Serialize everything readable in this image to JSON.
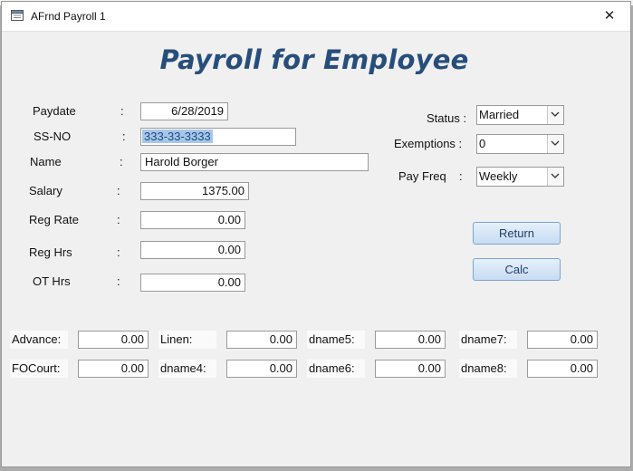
{
  "window": {
    "title": "AFrnd Payroll 1",
    "close_glyph": "✕",
    "icon": "form-icon"
  },
  "heading": "Payroll for Employee",
  "left_fields": [
    {
      "label": "Paydate",
      "colon": ":",
      "value": "6/28/2019"
    },
    {
      "label": "SS-NO",
      "colon": ":",
      "value": "333-33-3333"
    },
    {
      "label": "Name",
      "colon": ":",
      "value": "Harold Borger"
    },
    {
      "label": "Salary",
      "colon": ":",
      "value": "1375.00"
    },
    {
      "label": "Reg Rate",
      "colon": ":",
      "value": "0.00"
    },
    {
      "label": "Reg Hrs",
      "colon": ":",
      "value": "0.00"
    },
    {
      "label": "OT Hrs",
      "colon": ":",
      "value": "0.00"
    }
  ],
  "right_fields": [
    {
      "label": "Status :",
      "value": "Married"
    },
    {
      "label": "Exemptions :",
      "value": "0"
    },
    {
      "label": "Pay Freq",
      "colon": ":",
      "value": "Weekly"
    }
  ],
  "buttons": {
    "return": "Return",
    "calc": "Calc"
  },
  "deductions": [
    {
      "label": "Advance:",
      "value": "0.00"
    },
    {
      "label": "Linen:",
      "value": "0.00"
    },
    {
      "label": "dname5:",
      "value": "0.00"
    },
    {
      "label": "dname7:",
      "value": "0.00"
    },
    {
      "label": "FOCourt:",
      "value": "0.00"
    },
    {
      "label": "dname4:",
      "value": "0.00"
    },
    {
      "label": "dname6:",
      "value": "0.00"
    },
    {
      "label": "dname8:",
      "value": "0.00"
    }
  ],
  "colors": {
    "heading": "#274e7b",
    "button_bg": "#d6e6f7",
    "selection": "#a8c7e8"
  }
}
